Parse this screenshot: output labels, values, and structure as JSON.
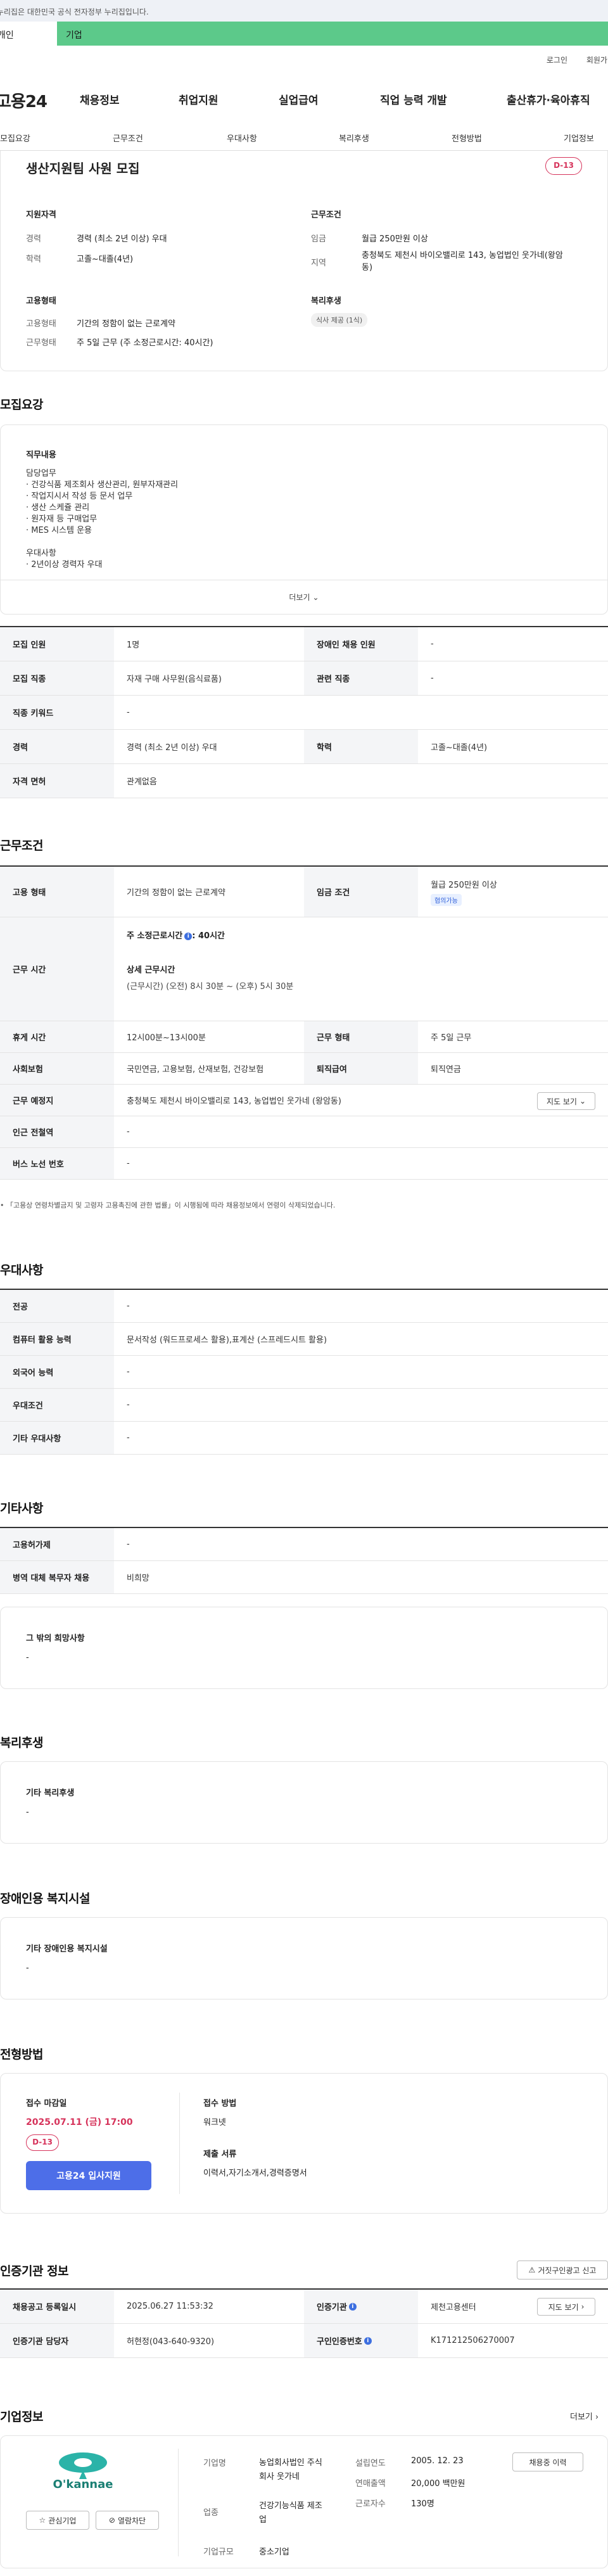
{
  "banner": {
    "text": "이 누리집은 대한민국 공식 전자정부 누리집입니다."
  },
  "user_tabs": {
    "personal": "개인",
    "corporate": "기업"
  },
  "top_links": {
    "login": "로그인",
    "join": "회원가입"
  },
  "gnb": {
    "logo": "고용24",
    "items": [
      "채용정보",
      "취업지원",
      "실업급여",
      "직업 능력 개발",
      "출산휴가·육아휴직"
    ]
  },
  "subnav": {
    "items": [
      "모집요강",
      "근무조건",
      "우대사항",
      "복리후생",
      "전형방법",
      "기업정보"
    ]
  },
  "summary": {
    "title": "생산지원팀 사원 모집",
    "dday": "D-13",
    "qual_title": "지원자격",
    "career_label": "경력",
    "career_value": "경력 (최소 2년 이상) 우대",
    "edu_label": "학력",
    "edu_value": "고졸~대졸(4년)",
    "cond_title": "근무조건",
    "wage_label": "임금",
    "wage_value": "월급 250만원 이상",
    "region_label": "지역",
    "region_value": "충청북도 제천시 바이오밸리로 143, 농업법인 웃가네(왕암동)",
    "emp_title": "고용형태",
    "emp_label": "고용형태",
    "emp_value": "기간의 정함이 없는 근로계약",
    "work_label": "근무형태",
    "work_value": "주 5일 근무 (주 소정근로시간: 40시간)",
    "welfare_title": "복리후생",
    "welfare_pill": "식사 제공 (1식)"
  },
  "recruit": {
    "section_title": "모집요강",
    "duty_title": "직무내용",
    "duty_lines": [
      "담당업무",
      "· 건강식품 제조회사 생산관리, 원부자재관리",
      "· 작업지시서 작성 등 문서 업무",
      "· 생산 스케쥴 관리",
      "· 원자재 등 구매업무",
      "· MES 시스템 운용",
      "",
      "우대사항",
      "· 2년이상 경력자 우대"
    ],
    "more_label": "더보기",
    "table": {
      "rows": [
        {
          "h1": "모집 인원",
          "v1": "1명",
          "h2": "장애인 채용 인원",
          "v2": "-"
        },
        {
          "h1": "모집 직종",
          "v1": "자재 구매 사무원(음식료품)",
          "h2": "관련 직종",
          "v2": "-"
        },
        {
          "h1": "직종 키워드",
          "v1": "-",
          "h2": "",
          "v2": ""
        },
        {
          "h1": "경력",
          "v1": "경력 (최소 2년 이상) 우대",
          "h2": "학력",
          "v2": "고졸~대졸(4년)"
        },
        {
          "h1": "자격 면허",
          "v1": "관계없음",
          "h2": "",
          "v2": ""
        }
      ]
    }
  },
  "workcond": {
    "section_title": "근무조건",
    "emp_h": "고용 형태",
    "emp_v": "기간의 정함이 없는 근로계약",
    "wage_h": "임금 조건",
    "wage_v": "월급 250만원 이상",
    "wage_badge": "협의가능",
    "time_h": "근무 시간",
    "hours_label": "주 소정근로시간",
    "hours_value": ": 40시간",
    "detail_label": "상세 근무시간",
    "detail_value": "(근무시간) (오전) 8시 30분 ~ (오후) 5시 30분",
    "rest_h": "휴게 시간",
    "rest_v": "12시00분~13시00분",
    "form_h": "근무 형태",
    "form_v": "주 5일 근무",
    "ins_h": "사회보험",
    "ins_v": "국민연금, 고용보험, 산재보험, 건강보험",
    "retire_h": "퇴직급여",
    "retire_v": "퇴직연금",
    "place_h": "근무 예정지",
    "place_v": "충청북도 제천시 바이오밸리로 143, 농업법인 웃가네 (왕암동)",
    "map_btn": "지도 보기",
    "subway_h": "인근 전철역",
    "subway_v": "-",
    "bus_h": "버스 노선 번호",
    "bus_v": "-",
    "notice": "「고용상 연령차별금지 및 고령자 고용촉진에 관한 법률」이 시행됨에 따라 채용정보에서 연령이 삭제되었습니다."
  },
  "pref": {
    "section_title": "우대사항",
    "rows": [
      {
        "h": "전공",
        "v": "-"
      },
      {
        "h": "컴퓨터 활용 능력",
        "v": "문서작성 (워드프로세스 활용),표계산 (스프레드시트 활용)"
      },
      {
        "h": "외국어 능력",
        "v": "-"
      },
      {
        "h": "우대조건",
        "v": "-"
      },
      {
        "h": "기타 우대사항",
        "v": "-"
      }
    ]
  },
  "etc": {
    "section_title": "기타사항",
    "rows": [
      {
        "h": "고용허가제",
        "v": "-"
      },
      {
        "h": "병역 대체 복무자 채용",
        "v": "비희망"
      }
    ],
    "other_title": "그 밖의 희망사항",
    "other_value": "-"
  },
  "welfare": {
    "section_title": "복리후생",
    "label": "기타 복리후생",
    "value": "-"
  },
  "disability": {
    "section_title": "장애인용 복지시설",
    "label": "기타 장애인용 복지시설",
    "value": "-"
  },
  "process": {
    "section_title": "전형방법",
    "deadline_label": "접수 마감일",
    "deadline_value": "2025.07.11 (금) 17:00",
    "dday": "D-13",
    "apply_btn": "고용24 입사지원",
    "method_label": "접수 방법",
    "method_value": "워크넷",
    "docs_label": "제출 서류",
    "docs_value": "이력서,자기소개서,경력증명서"
  },
  "agency": {
    "section_title": "인증기관 정보",
    "report_btn": "거짓구인광고 신고",
    "reg_h": "채용공고 등록일시",
    "reg_v": "2025.06.27 11:53:32",
    "org_h": "인증기관",
    "org_v": "제천고용센터",
    "map_btn": "지도 보기",
    "mgr_h": "인증기관 담당자",
    "mgr_v": "허현정(043-640-9320)",
    "num_h": "구인인증번호",
    "num_v": "K171212506270007"
  },
  "company": {
    "section_title": "기업정보",
    "more": "더보기",
    "logo_text": "O'kannae",
    "fav_btn": "관심기업",
    "block_btn": "열람차단",
    "name_h": "기업명",
    "name_v": "농업회사법인 주식회사 웃가네",
    "industry_h": "업종",
    "industry_v": "건강기능식품 제조업",
    "size_h": "기업규모",
    "size_v": "중소기업",
    "est_h": "설립연도",
    "est_v": "2005. 12. 23",
    "sales_h": "연매출액",
    "sales_v": "20,000 백만원",
    "emp_h": "근로자수",
    "emp_v": "130명",
    "jobs_btn": "채용중 이력"
  },
  "colors": {
    "green": "#5cc98a",
    "red": "#d6335b",
    "blue": "#4d6ee8"
  }
}
